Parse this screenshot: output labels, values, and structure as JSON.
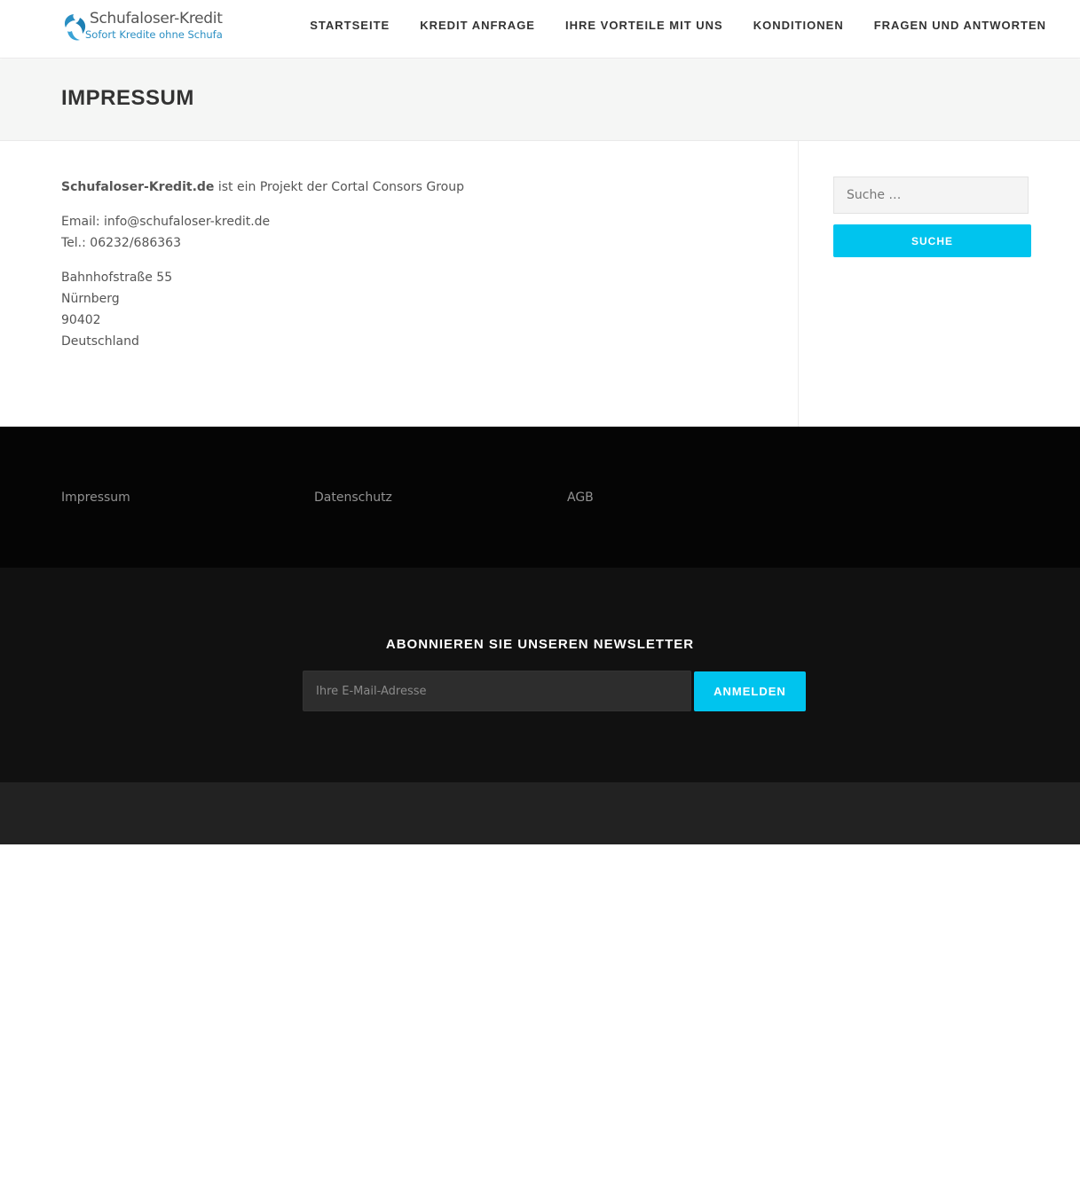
{
  "header": {
    "logo_title": "Schufaloser-Kredit",
    "logo_tagline": "Sofort Kredite ohne Schufa",
    "nav": [
      {
        "label": "STARTSEITE"
      },
      {
        "label": "KREDIT ANFRAGE"
      },
      {
        "label": "IHRE VORTEILE MIT UNS"
      },
      {
        "label": "KONDITIONEN"
      },
      {
        "label": "FRAGEN UND ANTWORTEN"
      }
    ]
  },
  "page": {
    "title": "IMPRESSUM"
  },
  "content": {
    "intro_bold": "Schufaloser-Kredit.de",
    "intro_rest": " ist ein Projekt der Cortal Consors Group",
    "email": "Email: info@schufaloser-kredit.de",
    "phone": "Tel.: 06232/686363",
    "street": "Bahnhofstraße 55",
    "city": "Nürnberg",
    "zip": "90402",
    "country": "Deutschland"
  },
  "sidebar": {
    "search_placeholder": "Suche …",
    "search_button": "SUCHE"
  },
  "footer": {
    "links": [
      {
        "label": "Impressum"
      },
      {
        "label": "Datenschutz"
      },
      {
        "label": "AGB"
      }
    ]
  },
  "newsletter": {
    "title": "ABONNIEREN SIE UNSEREN NEWSLETTER",
    "placeholder": "Ihre E-Mail-Adresse",
    "button": "ANMELDEN"
  },
  "colors": {
    "accent": "#00c4ee",
    "logo_blue": "#2a8fc3"
  }
}
